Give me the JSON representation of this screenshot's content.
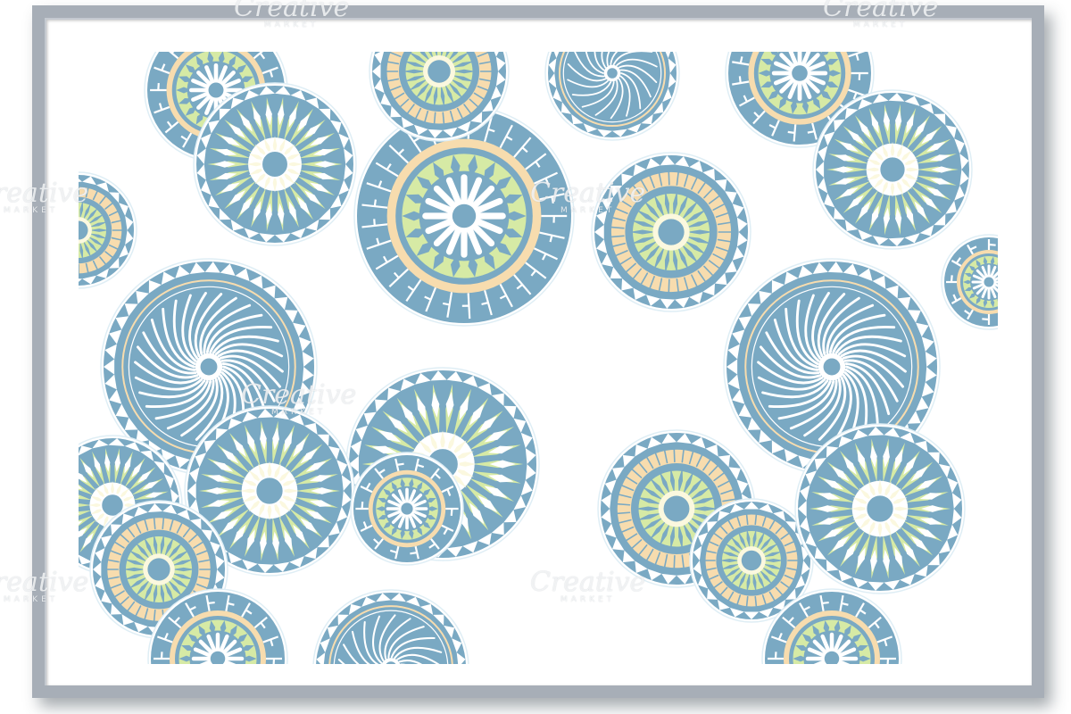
{
  "image": {
    "subject": "framed seamless pattern of circular mandala ornaments",
    "colors": {
      "frame": "#a7aeb7",
      "mat": "#ffffff",
      "blue": "#7aa9c3",
      "green": "#d6eaa5",
      "peach": "#f7dcae",
      "cream": "#fbf8df"
    }
  },
  "watermark": {
    "brand": "Creative",
    "sub": "MARKET"
  },
  "mandalas": [
    {
      "style": "greek"
    },
    {
      "style": "flower"
    },
    {
      "style": "greek"
    },
    {
      "style": "ring"
    },
    {
      "style": "swirl"
    },
    {
      "style": "greek"
    },
    {
      "style": "flower"
    },
    {
      "style": "ring"
    },
    {
      "style": "swirl"
    },
    {
      "style": "flower"
    },
    {
      "style": "ring"
    },
    {
      "style": "swirl"
    },
    {
      "style": "flower"
    },
    {
      "style": "greek"
    },
    {
      "style": "ring"
    },
    {
      "style": "flower"
    },
    {
      "style": "greek"
    },
    {
      "style": "ring"
    },
    {
      "style": "swirl"
    },
    {
      "style": "ring"
    },
    {
      "style": "greek"
    },
    {
      "style": "greek"
    },
    {
      "style": "flower"
    }
  ]
}
